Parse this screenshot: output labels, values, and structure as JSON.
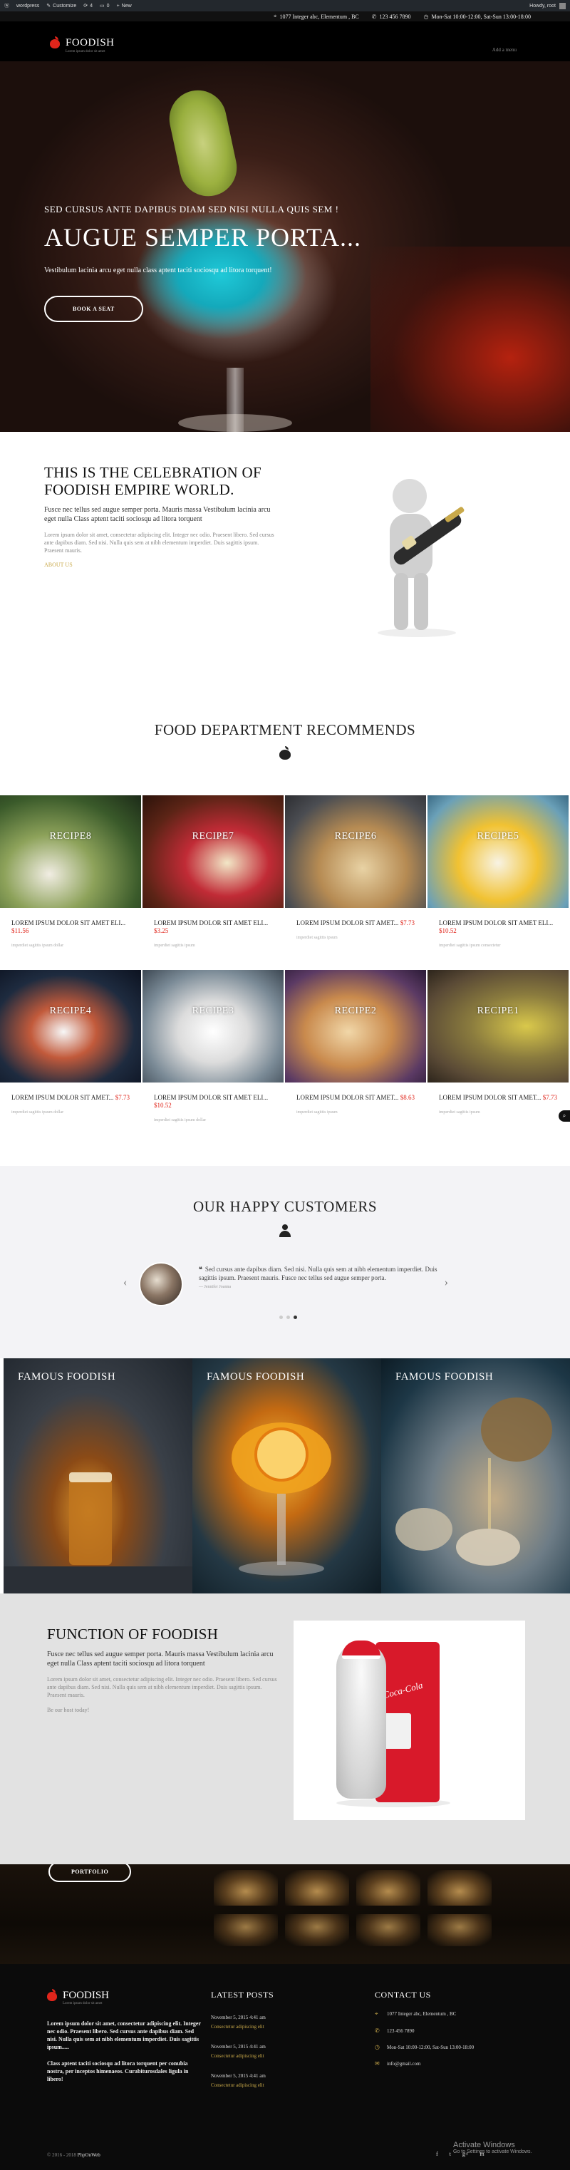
{
  "adminbar": {
    "items": [
      "wordpress",
      "Customize",
      "4",
      "0",
      "New"
    ],
    "greeting": "Howdy, root"
  },
  "topbar": {
    "address": "1077 Integer abc, Elementum , BC",
    "phone": "123 456 7890",
    "hours": "Mon-Sat 10:00-12:00, Sat-Sun 13:00-18:00"
  },
  "header": {
    "logo_name": "FOODISH",
    "tagline": "Lorem ipsum dolor sit amet",
    "add_menu": "Add a menu"
  },
  "hero": {
    "subtitle": "SED CURSUS ANTE DAPIBUS DIAM SED NISI NULLA QUIS SEM !",
    "title": "AUGUE SEMPER PORTA...",
    "description": "Vestibulum lacinia arcu eget nulla class aptent taciti sociosqu ad litora torquent!",
    "button": "BOOK A SEAT"
  },
  "celebration": {
    "title": "THIS IS THE CELEBRATION OF FOODISH EMPIRE WORLD.",
    "lead": "Fusce nec tellus sed augue semper porta. Mauris massa Vestibulum lacinia arcu eget nulla Class aptent taciti sociosqu ad litora torquent",
    "body": "Lorem ipsum dolor sit amet, consectetur adipiscing elit. Integer nec odio. Praesent libero. Sed cursus ante dapibus diam. Sed nisi. Nulla quis sem at nibh elementum imperdiet. Duis sagittis ipsum. Praesent mauris.",
    "link": "ABOUT US"
  },
  "food": {
    "title": "FOOD DEPARTMENT RECOMMENDS",
    "recipes": [
      {
        "label": "RECIPE8",
        "title": "LOREM IPSUM DOLOR SIT AMET Eli...",
        "price": "$11.56",
        "ing": "imperdiet sagittis ipsum dollar"
      },
      {
        "label": "RECIPE7",
        "title": "LOREM IPSUM DOLOR SIT AMET Eli...",
        "price": "$3.25",
        "ing": "imperdiet sagittis ipsum"
      },
      {
        "label": "RECIPE6",
        "title": "LOREM IPSUM DOLOR SIT AMET...",
        "price": "$7.73",
        "ing": "imperdiet sagittis ipsum"
      },
      {
        "label": "RECIPE5",
        "title": "LOREM IPSUM DOLOR SIT AMET Eli...",
        "price": "$10.52",
        "ing": "imperdiet sagittis ipsum consectetur"
      },
      {
        "label": "RECIPE4",
        "title": "LOREM IPSUM DOLOR SIT AMET...",
        "price": "$7.73",
        "ing": "imperdiet sagittis ipsum dollar"
      },
      {
        "label": "RECIPE3",
        "title": "LOREM IPSUM DOLOR SIT AMET Eli...",
        "price": "$10.52",
        "ing": "imperdiet sagittis ipsum dollar"
      },
      {
        "label": "RECIPE2",
        "title": "LOREM IPSUM DOLOR SIT AMET...",
        "price": "$8.63",
        "ing": "imperdiet sagittis ipsum"
      },
      {
        "label": "RECIPE1",
        "title": "LOREM IPSUM DOLOR SIT AMET...",
        "price": "$7.73",
        "ing": "imperdiet sagittis ipsum"
      }
    ]
  },
  "customers": {
    "title": "OUR HAPPY CUSTOMERS",
    "quote": "Sed cursus ante dapibus diam. Sed nisi. Nulla quis sem at nibh elementum imperdiet. Duis sagittis ipsum. Praesent mauris. Fusce nec tellus sed augue semper porta.",
    "author": "— Jennifer Joanna"
  },
  "famous": {
    "labels": [
      "FAMOUS FOODISH",
      "FAMOUS FOODISH",
      "FAMOUS FOODISH"
    ]
  },
  "function": {
    "title": "FUNCTION OF FOODISH",
    "lead": "Fusce nec tellus sed augue semper porta. Mauris massa Vestibulum lacinia arcu eget nulla Class aptent taciti sociosqu ad litora torquent",
    "body": "Lorem ipsum dolor sit amet, consectetur adipiscing elit. Integer nec odio. Praesent libero. Sed cursus ante dapibus diam. Sed nisi. Nulla quis sem at nibh elementum imperdiet. Duis sagittis ipsum. Praesent mauris.",
    "note": "Be our host today!",
    "fridge_logo": "Coca-Cola"
  },
  "portfolio": {
    "button": "PORTFOLIO"
  },
  "footer": {
    "logo_name": "FOODISH",
    "tagline": "Lorem ipsum dolor sit amet",
    "about1": "Lorem ipsum dolor sit amet, consectetur adipiscing elit. Integer nec odio. Praesent libero. Sed cursus ante dapibus diam. Sed nisi. Nulla quis sem at nibh elementum imperdiet. Duis sagittis ipsum.....",
    "about2": "Class aptent taciti sociosqu ad litora torquent per conubia nostra, per inceptos himenaeos. Curabiturosdales ligula in libero!",
    "posts_title": "LATEST POSTS",
    "posts": [
      {
        "date": "November 5, 2015 4:41 am",
        "title": "Consectetur adipiscing elit"
      },
      {
        "date": "November 5, 2015 4:41 am",
        "title": "Consectetur adipiscing elit"
      },
      {
        "date": "November 5, 2015 4:41 am",
        "title": "Consectetur adipiscing elit"
      }
    ],
    "contact_title": "CONTACT US",
    "contact": {
      "address": "1077 Integer abc, Elementum , BC",
      "phone": "123 456 7890",
      "hours": "Mon-Sat 10:00-12:00, Sat-Sun 13:00-18:00",
      "email": "info@gmail.com"
    },
    "copyright_prefix": "© 2016 - 2018",
    "copyright_brand": "PhpOnWeb",
    "activate_title": "Activate Windows",
    "activate_sub": "Go to Settings to activate Windows."
  },
  "colors": {
    "accent_red": "#e0251b",
    "gold": "#c9a94a",
    "dark": "#000000"
  }
}
